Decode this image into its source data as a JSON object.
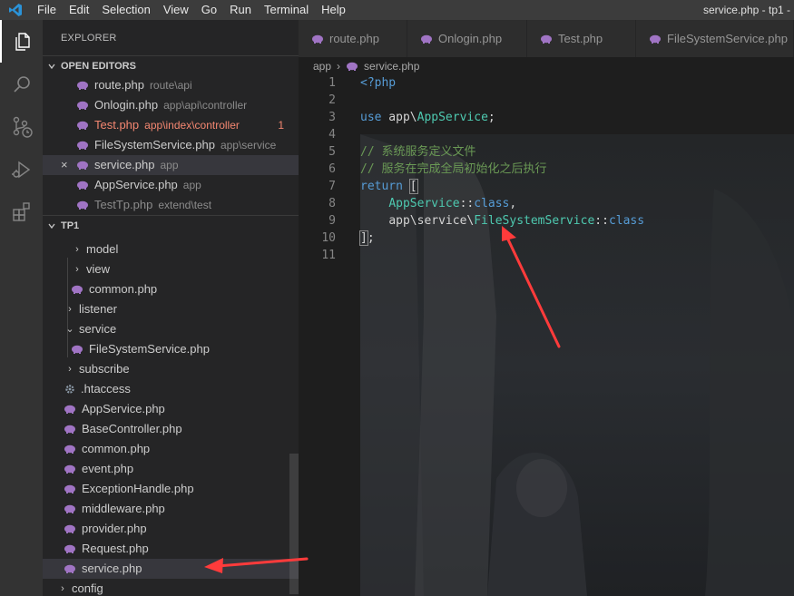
{
  "menu": {
    "items": [
      {
        "label": "File"
      },
      {
        "label": "Edit"
      },
      {
        "label": "Selection"
      },
      {
        "label": "View"
      },
      {
        "label": "Go"
      },
      {
        "label": "Run"
      },
      {
        "label": "Terminal"
      },
      {
        "label": "Help"
      }
    ],
    "window_title": "service.php - tp1 -"
  },
  "activity": {
    "icons": [
      "explorer-icon",
      "search-icon",
      "source-control-icon",
      "run-debug-icon",
      "extensions-icon"
    ]
  },
  "sidebar": {
    "title": "EXPLORER",
    "open_editors": {
      "heading": "OPEN EDITORS",
      "items": [
        {
          "name": "route.php",
          "desc": "route\\api"
        },
        {
          "name": "Onlogin.php",
          "desc": "app\\api\\controller"
        },
        {
          "name": "Test.php",
          "desc": "app\\index\\controller",
          "badge": "1"
        },
        {
          "name": "FileSystemService.php",
          "desc": "app\\service"
        },
        {
          "name": "service.php",
          "desc": "app",
          "close": "×"
        },
        {
          "name": "AppService.php",
          "desc": "app"
        },
        {
          "name": "TestTp.php",
          "desc": "extend\\test"
        }
      ]
    },
    "project": {
      "heading": "TP1",
      "items": [
        {
          "label": "model"
        },
        {
          "label": "view"
        },
        {
          "label": "common.php"
        },
        {
          "label": "listener"
        },
        {
          "label": "service"
        },
        {
          "label": "FileSystemService.php"
        },
        {
          "label": "subscribe"
        },
        {
          "label": ".htaccess"
        },
        {
          "label": "AppService.php"
        },
        {
          "label": "BaseController.php"
        },
        {
          "label": "common.php"
        },
        {
          "label": "event.php"
        },
        {
          "label": "ExceptionHandle.php"
        },
        {
          "label": "middleware.php"
        },
        {
          "label": "provider.php"
        },
        {
          "label": "Request.php"
        },
        {
          "label": "service.php"
        },
        {
          "label": "config"
        }
      ]
    }
  },
  "tabs": [
    {
      "label": "route.php"
    },
    {
      "label": "Onlogin.php"
    },
    {
      "label": "Test.php"
    },
    {
      "label": "FileSystemService.php"
    }
  ],
  "breadcrumb": {
    "folder": "app",
    "file": "service.php"
  },
  "editor": {
    "line_numbers": [
      "1",
      "2",
      "3",
      "4",
      "5",
      "6",
      "7",
      "8",
      "9",
      "10",
      "11"
    ],
    "code": {
      "l1": "<?php",
      "l3_kw": "use",
      "l3_ns": " app\\",
      "l3_cls": "AppService",
      "l3_end": ";",
      "l5": "// 系统服务定义文件",
      "l6": "// 服务在完成全局初始化之后执行",
      "l7_kw": "return",
      "l7_br": "[",
      "l8_cls": "AppService",
      "l8_op": "::",
      "l8_kw": "class",
      "l8_end": ",",
      "l9_ns": "app\\service\\",
      "l9_cls": "FileSystemService",
      "l9_op": "::",
      "l9_kw": "class",
      "l10_br": "]",
      "l10_end": ";"
    }
  },
  "colors": {
    "php_icon": "#a074c4",
    "keyword": "#569cd6",
    "comment": "#6a9955",
    "type": "#4ec9b0",
    "error": "#f48771",
    "arrow": "#ff3b3b"
  }
}
